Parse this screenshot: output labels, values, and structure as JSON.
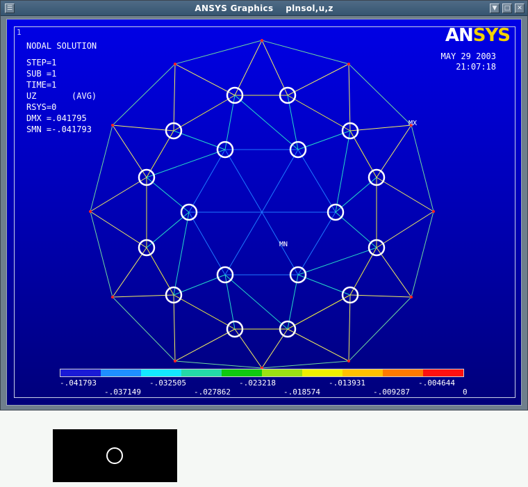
{
  "window": {
    "title": "ANSYS Graphics",
    "command": "plnsol,u,z"
  },
  "titlebar_buttons": [
    "minimize-icon",
    "maximize-icon",
    "close-icon",
    "menu-icon"
  ],
  "viewport": {
    "window_number": "1",
    "logo": {
      "part_a": "AN",
      "part_b": "SYS"
    },
    "date": "MAY 29 2003",
    "time": "21:07:18",
    "info": {
      "line1": "NODAL SOLUTION",
      "line2": "STEP=1",
      "line3": "SUB =1",
      "line4": "TIME=1",
      "line5": "UZ       (AVG)",
      "line6": "RSYS=0",
      "line7": "DMX =.041795",
      "line8": "SMN =-.041793"
    },
    "labels": {
      "max": "MX",
      "min": "MN"
    }
  },
  "contour_legend": {
    "colors": [
      "#1a1ad6",
      "#1f8fff",
      "#14e8ff",
      "#24d8a8",
      "#10c810",
      "#9ce014",
      "#f0f000",
      "#ffc000",
      "#ff7a00",
      "#ff1010"
    ],
    "top_labels": [
      "-.041793",
      "-.032505",
      "-.023218",
      "-.013931",
      "-.004644"
    ],
    "bottom_labels": [
      "-.037149",
      "-.027862",
      "-.018574",
      "-.009287",
      "0"
    ]
  }
}
